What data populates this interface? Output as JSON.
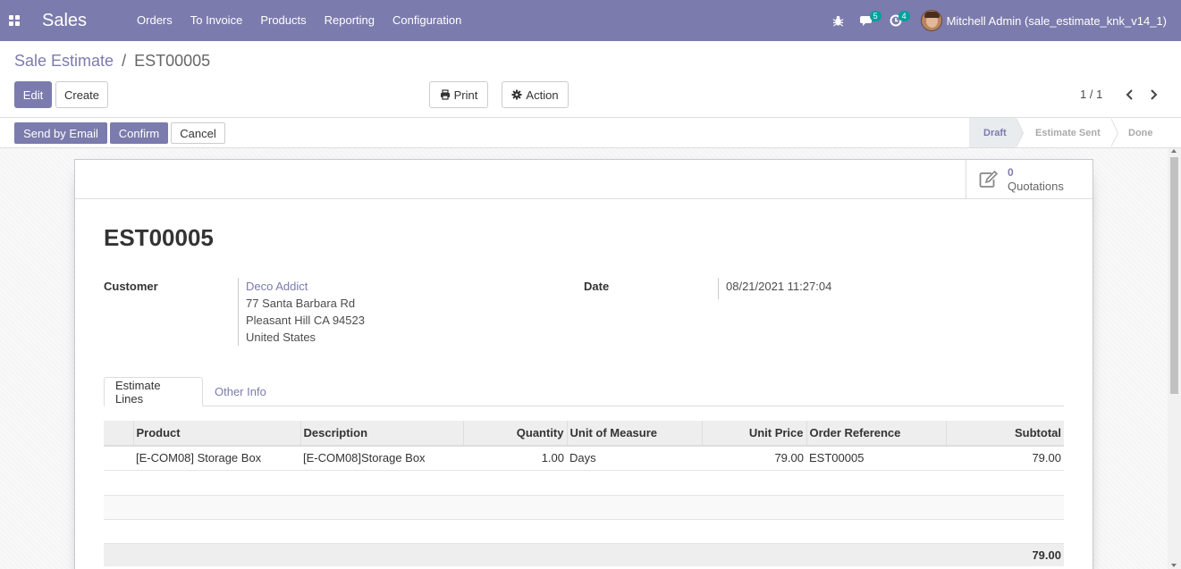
{
  "navbar": {
    "app_name": "Sales",
    "menu": [
      "Orders",
      "To Invoice",
      "Products",
      "Reporting",
      "Configuration"
    ],
    "messages_count": "5",
    "activities_count": "4",
    "user_name": "Mitchell Admin (sale_estimate_knk_v14_1)",
    "bar_color": "#7c7bad"
  },
  "breadcrumb": {
    "parent": "Sale Estimate",
    "separator": "/",
    "current": "EST00005"
  },
  "control_panel": {
    "edit_label": "Edit",
    "create_label": "Create",
    "print_label": "Print",
    "action_label": "Action",
    "pager": "1 / 1"
  },
  "statusbar": {
    "send_label": "Send by Email",
    "confirm_label": "Confirm",
    "cancel_label": "Cancel",
    "stages": [
      "Draft",
      "Estimate Sent",
      "Done"
    ],
    "active_stage": "Draft"
  },
  "smart_button": {
    "value": "0",
    "label": "Quotations",
    "icon": "pencil-square-icon"
  },
  "record": {
    "title": "EST00005",
    "customer_label": "Customer",
    "customer_name": "Deco Addict",
    "address_line1": "77 Santa Barbara Rd",
    "address_line2": "Pleasant Hill CA 94523",
    "address_line3": "United States",
    "date_label": "Date",
    "date_value": "08/21/2021 11:27:04"
  },
  "tabs": {
    "estimate_lines": "Estimate Lines",
    "other_info": "Other Info"
  },
  "lines_table": {
    "headers": {
      "product": "Product",
      "description": "Description",
      "quantity": "Quantity",
      "uom": "Unit of Measure",
      "unit_price": "Unit Price",
      "order_ref": "Order Reference",
      "subtotal": "Subtotal"
    },
    "rows": [
      {
        "product": "[E-COM08] Storage Box",
        "description": "[E-COM08]Storage Box",
        "quantity": "1.00",
        "uom": "Days",
        "unit_price": "79.00",
        "order_ref": "EST00005",
        "subtotal": "79.00"
      }
    ],
    "total": "79.00"
  }
}
